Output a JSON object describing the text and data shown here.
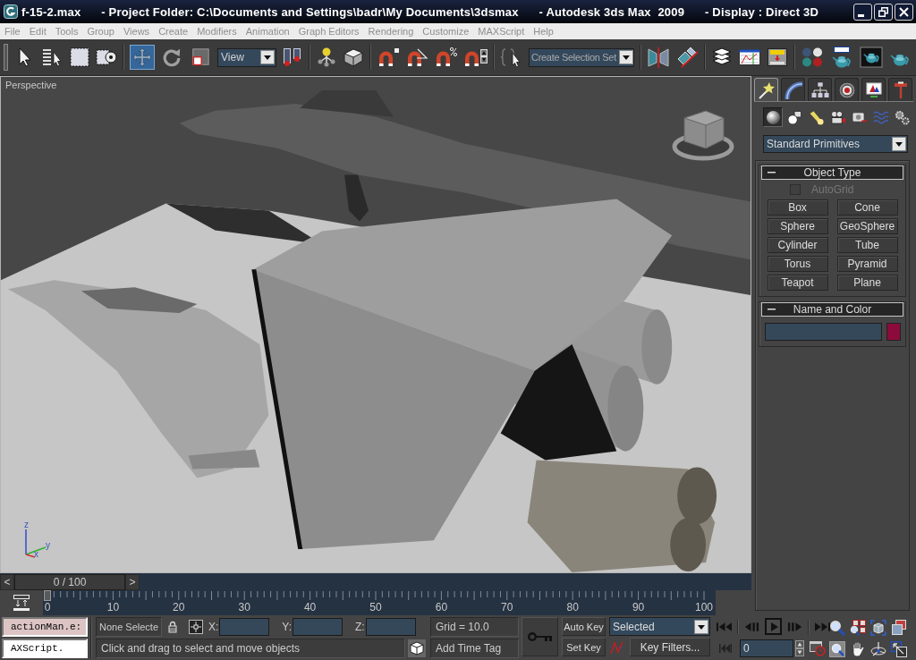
{
  "window": {
    "title": "f-15-2.max      - Project Folder: C:\\Documents and Settings\\badr\\My Documents\\3dsmax      - Autodesk 3ds Max  2009      - Display : Direct 3D"
  },
  "menu": [
    "File",
    "Edit",
    "Tools",
    "Group",
    "Views",
    "Create",
    "Modifiers",
    "Animation",
    "Graph Editors",
    "Rendering",
    "Customize",
    "MAXScript",
    "Help"
  ],
  "toolbar": {
    "mode_tools": [
      {
        "selected": false
      },
      {
        "selected": true
      },
      {
        "selected": false
      },
      {
        "selected": false
      }
    ],
    "reference_coordinate_system": "View",
    "selection_set": {
      "placeholder": "Create Selection Set"
    }
  },
  "viewport": {
    "label": "Perspective",
    "axis_labels": [
      "z",
      "x",
      "y"
    ]
  },
  "command_panel": {
    "tabs": [
      {
        "selected": true
      },
      {
        "selected": false
      },
      {
        "selected": false
      },
      {
        "selected": false
      },
      {
        "selected": false
      },
      {
        "selected": false
      }
    ],
    "categories": [
      {
        "selected": true
      },
      {
        "selected": false
      },
      {
        "selected": false
      },
      {
        "selected": false
      },
      {
        "selected": false
      },
      {
        "selected": false
      },
      {
        "selected": false
      }
    ],
    "category_dropdown": "Standard Primitives",
    "rollouts": [
      {
        "kind": "buttons",
        "title": "Object Type",
        "expanded": true,
        "checkbox": {
          "label": "AutoGrid",
          "checked": false,
          "disabled": true
        },
        "buttons": [
          "Box",
          "Cone",
          "Sphere",
          "GeoSphere",
          "Cylinder",
          "Tube",
          "Torus",
          "Pyramid",
          "Teapot",
          "Plane"
        ]
      },
      {
        "kind": "name_color",
        "title": "Name and Color",
        "expanded": true,
        "color": "#8c0b3c"
      }
    ]
  },
  "time_slider": {
    "previous": "<",
    "label": "0 / 100",
    "next": ">",
    "level": 0
  },
  "track_bar": {
    "labels": [
      "0",
      "10",
      "20",
      "30",
      "40",
      "50",
      "60",
      "70",
      "80",
      "90",
      "100"
    ]
  },
  "maxscript": {
    "recorder": "actionMan.e:",
    "input": "AXScript."
  },
  "status": {
    "selection": "None Selecte",
    "coordinates": [
      "X:",
      "Y:",
      "Z:"
    ],
    "grid": "Grid = 10.0",
    "prompt": "Click and drag to select and move objects",
    "time_tag": "Add Time Tag"
  },
  "animation": {
    "auto_key": {
      "label": "Auto Key",
      "on": false
    },
    "set_key": "Set Key",
    "key_set": "Selected",
    "key_filters": "Key Filters...",
    "frame": "0"
  }
}
